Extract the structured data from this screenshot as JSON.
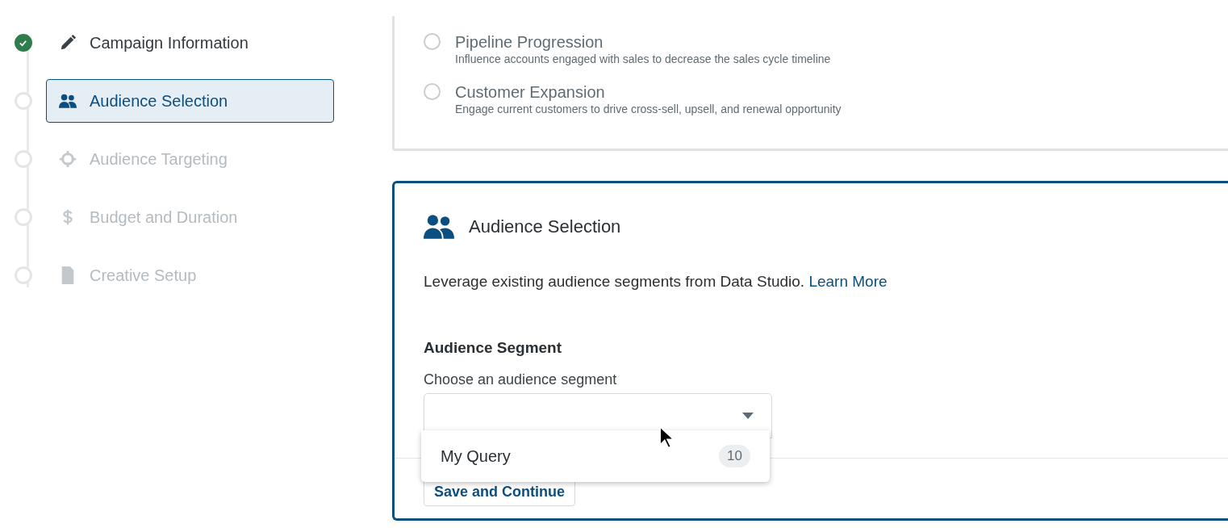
{
  "steps": [
    {
      "kind": "pencil",
      "label": "Campaign Information",
      "completed": true,
      "disabled": false,
      "selected": false
    },
    {
      "kind": "people",
      "label": "Audience Selection",
      "completed": false,
      "disabled": false,
      "selected": true
    },
    {
      "kind": "crosshair",
      "label": "Audience Targeting",
      "completed": false,
      "disabled": true,
      "selected": false
    },
    {
      "kind": "dollar",
      "label": "Budget and Duration",
      "completed": false,
      "disabled": true,
      "selected": false
    },
    {
      "kind": "image",
      "label": "Creative Setup",
      "completed": false,
      "disabled": true,
      "selected": false
    }
  ],
  "goals": [
    {
      "title": "Pipeline Progression",
      "description": "Influence accounts engaged with sales to decrease the sales cycle timeline",
      "selected": false
    },
    {
      "title": "Customer Expansion",
      "description": "Engage current customers to drive cross-sell, upsell, and renewal opportunity",
      "selected": false
    }
  ],
  "audience_card": {
    "title": "Audience Selection",
    "description": "Leverage existing audience segments from Data Studio.",
    "link": "Learn More",
    "section_title": "Audience Segment",
    "field_label": "Choose an audience segment",
    "dropdown_open": true,
    "options": [
      {
        "label": "My Query",
        "count": "10"
      }
    ],
    "save_button": "Save and Continue"
  }
}
